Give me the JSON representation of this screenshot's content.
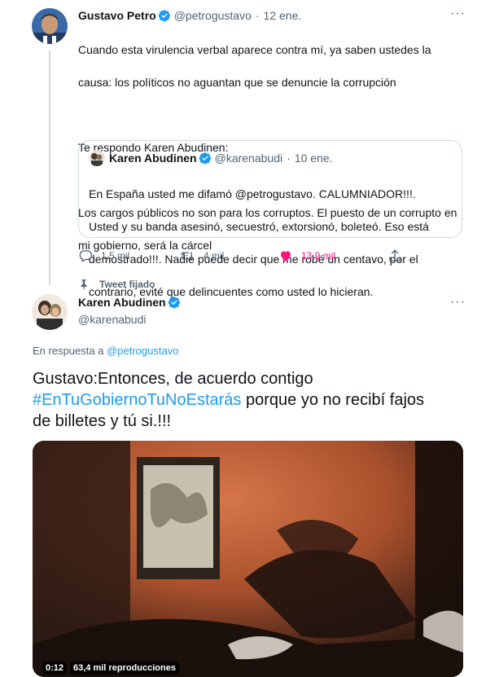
{
  "tweet1": {
    "author_name": "Gustavo Petro",
    "handle": "@petrogustavo",
    "separator": "·",
    "date": "12 ene.",
    "more_label": "···",
    "line1": "Cuando esta virulencia verbal aparece contra mí, ya saben ustedes la",
    "line2": "causa: los políticos no aguantan que se denuncie la corrupción",
    "line3": "Te respondo Karen Abudinen:",
    "line4": "Los cargos públicos no son para los corruptos. El puesto de un corrupto en",
    "line5": "mi gobierno, será la cárcel",
    "quote": {
      "author_name": "Karen Abudinen",
      "handle": "@karenabudi",
      "separator": "·",
      "date": "10 ene.",
      "line1": "En España usted me difamó @petrogustavo. CALUMNIADOR!!!.",
      "line2": "Usted y su banda asesinó, secuestró, extorsionó, boleteó. Eso está",
      "line3": "demostrado!!!. Nadie puede decir que me robé un centavo, por el",
      "line4": "contrario, evité que delincuentes como usted lo hicieran."
    },
    "actions": {
      "replies": "1,5 mil",
      "retweets": "4 mil",
      "likes": "13,9 mil"
    }
  },
  "tweet2": {
    "pinned_label": "Tweet fijado",
    "author_name": "Karen Abudinen",
    "handle": "@karenabudi",
    "more_label": "···",
    "reply_prefix": "En respuesta a",
    "reply_to": "@petrogustavo",
    "text_line1": "Gustavo:Entonces, de acuerdo contigo",
    "hashtag": "#EnTuGobiernoTuNoEstarás",
    "text_line2_rest": " porque yo no recibí fajos",
    "text_line3": "de billetes y tú si.!!!",
    "video": {
      "time": "0:12",
      "views": "63,4 mil reproducciones"
    }
  },
  "colors": {
    "brand_blue": "#1d9bf0",
    "like_pink": "#f91880",
    "muted_text": "#536471",
    "border": "#cfd9de"
  },
  "icons": [
    "verified-badge-icon",
    "reply-icon",
    "retweet-icon",
    "heart-icon",
    "share-icon",
    "pin-icon",
    "more-icon"
  ]
}
